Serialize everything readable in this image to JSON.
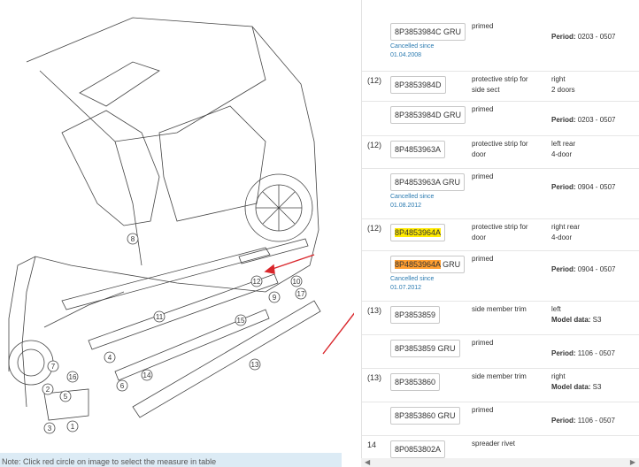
{
  "diagram": {
    "callouts": [
      "8",
      "12",
      "10",
      "17",
      "11",
      "9",
      "7",
      "16",
      "4",
      "6",
      "14",
      "15",
      "13",
      "2",
      "5",
      "3",
      "1"
    ]
  },
  "note": "Note: Click red circle on image to select the measure in table",
  "rows": [
    {
      "num": "",
      "pn": "8P3853984C GRU",
      "cancel1": "Cancelled since",
      "cancel2": "01.04.2008",
      "desc": "primed",
      "rem1": "",
      "rem2": "Period:",
      "rem2v": " 0203 - 0507"
    },
    {
      "num": "(12)",
      "pn": "8P3853984D",
      "desc": "protective strip for side sect",
      "rem1": "right",
      "rem2": "2 doors",
      "rem2v": ""
    },
    {
      "num": "",
      "pn": "8P3853984D GRU",
      "desc": "primed",
      "rem1": "",
      "rem2": "Period:",
      "rem2v": " 0203 - 0507"
    },
    {
      "num": "(12)",
      "pn": "8P4853963A",
      "desc": "protective strip for door",
      "rem1": "left rear",
      "rem2": "4-door",
      "rem2v": ""
    },
    {
      "num": "",
      "pn": "8P4853963A GRU",
      "cancel1": "Cancelled since",
      "cancel2": "01.08.2012",
      "desc": "primed",
      "rem1": "",
      "rem2": "Period:",
      "rem2v": " 0904 - 0507"
    },
    {
      "num": "(12)",
      "pn": "8P4853964A",
      "desc": "protective strip for door",
      "rem1": "right rear",
      "rem2": "4-door",
      "rem2v": ""
    },
    {
      "num": "",
      "pn": "8P4853964A GRU",
      "cancel1": "Cancelled since",
      "cancel2": "01.07.2012",
      "desc": "primed",
      "rem1": "",
      "rem2": "Period:",
      "rem2v": " 0904 - 0507"
    },
    {
      "num": "(13)",
      "pn": "8P3853859",
      "desc": "side member trim",
      "rem1": "left",
      "rem2": "Model data:",
      "rem2v": " S3"
    },
    {
      "num": "",
      "pn": "8P3853859 GRU",
      "desc": "primed",
      "rem1": "",
      "rem2": "Period:",
      "rem2v": " 1106 - 0507"
    },
    {
      "num": "(13)",
      "pn": "8P3853860",
      "desc": "side member trim",
      "rem1": "right",
      "rem2": "Model data:",
      "rem2v": " S3"
    },
    {
      "num": "",
      "pn": "8P3853860 GRU",
      "desc": "primed",
      "rem1": "",
      "rem2": "Period:",
      "rem2v": " 1106 - 0507"
    },
    {
      "num": "14",
      "pn": "8P0853802A",
      "desc": "spreader rivet",
      "rem1": "",
      "rem2": "",
      "rem2v": ""
    }
  ],
  "colors": {
    "highlight_yellow": "#ffea00",
    "highlight_orange": "#ff9e30",
    "arrow": "#d9262b",
    "link": "#2a7ab0"
  }
}
